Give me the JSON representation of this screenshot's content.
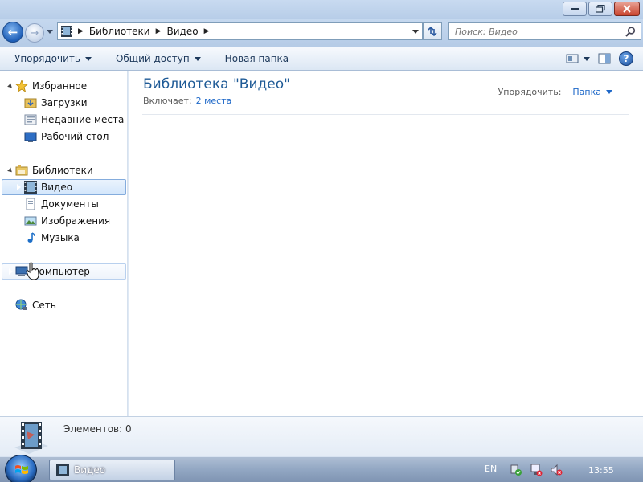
{
  "window": {
    "buttons": {
      "minimize": "minimize",
      "maximize": "maximize",
      "close": "close"
    }
  },
  "nav": {
    "breadcrumbs": [
      "Библиотеки",
      "Видео"
    ],
    "search_placeholder": "Поиск: Видео"
  },
  "toolbar": {
    "organize_label": "Упорядочить",
    "share_label": "Общий доступ",
    "new_folder_label": "Новая папка"
  },
  "sidebar": {
    "favorites_label": "Избранное",
    "downloads_label": "Загрузки",
    "recent_label": "Недавние места",
    "desktop_label": "Рабочий стол",
    "libraries_label": "Библиотеки",
    "video_label": "Видео",
    "documents_label": "Документы",
    "images_label": "Изображения",
    "music_label": "Музыка",
    "computer_label": "Компьютер",
    "network_label": "Сеть"
  },
  "main": {
    "library_title": "Библиотека \"Видео\"",
    "includes_label": "Включает:",
    "includes_link": "2 места",
    "arrange_label": "Упорядочить:",
    "arrange_value": "Папка"
  },
  "details": {
    "items_count": "Элементов: 0"
  },
  "taskbar": {
    "window_label": "Видео",
    "language": "EN",
    "time": "13:55"
  },
  "colors": {
    "accent": "#1e68c8",
    "title_blue": "#1e5a96"
  }
}
